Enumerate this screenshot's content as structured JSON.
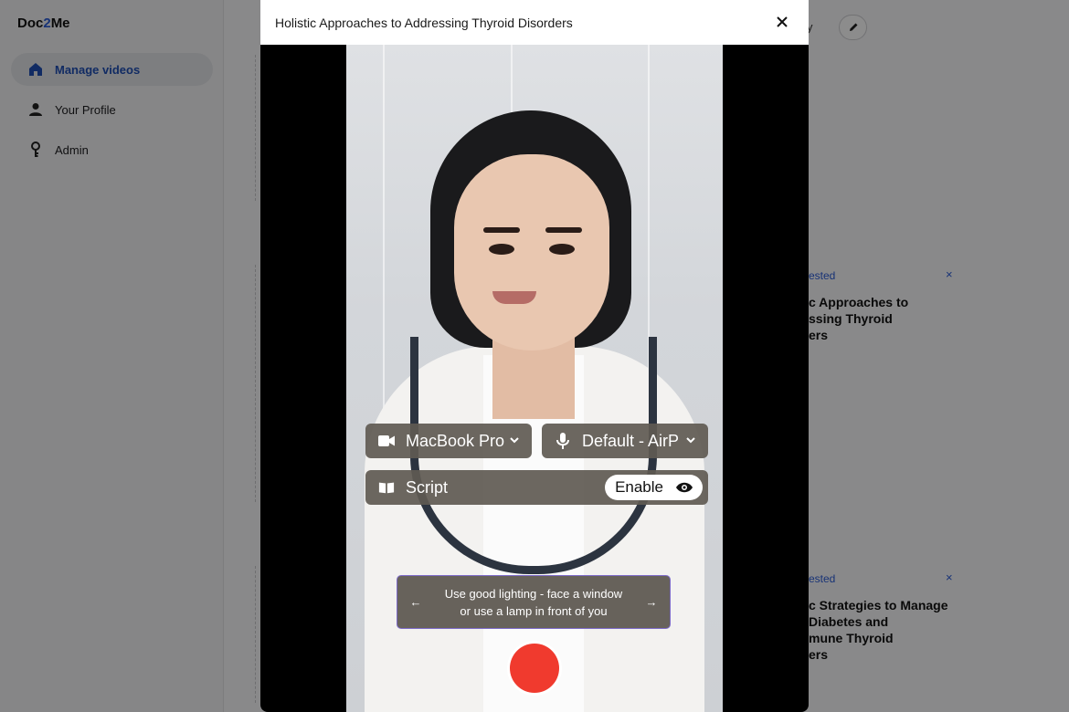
{
  "app": {
    "logo_prefix": "Doc",
    "logo_accent": "2",
    "logo_suffix": "Me",
    "accent_color": "#2a5bd7"
  },
  "sidebar": {
    "items": [
      {
        "label": "Manage videos",
        "icon": "home-icon",
        "active": true
      },
      {
        "label": "Your Profile",
        "icon": "person-icon",
        "active": false
      },
      {
        "label": "Admin",
        "icon": "key-icon",
        "active": false
      }
    ]
  },
  "background": {
    "header_partial": "sity",
    "cards": [
      {
        "status": "ested",
        "title_lines": [
          "c Approaches to",
          "ssing Thyroid",
          "ers"
        ]
      },
      {
        "status": "ested",
        "title_lines": [
          "c Strategies to Manage",
          " Diabetes and",
          "mune Thyroid",
          "ers"
        ]
      }
    ],
    "close_glyph": "×"
  },
  "modal": {
    "title": "Holistic Approaches to Addressing Thyroid Disorders",
    "camera_select": "MacBook Pro",
    "mic_select": "Default - AirP",
    "script_label": "Script",
    "script_toggle": "Enable",
    "tip_text_line1": "Use good lighting - face a window",
    "tip_text_line2": "or use a lamp in front of you",
    "tip_prev": "←",
    "tip_next": "→",
    "record_color": "#f03a2e"
  }
}
